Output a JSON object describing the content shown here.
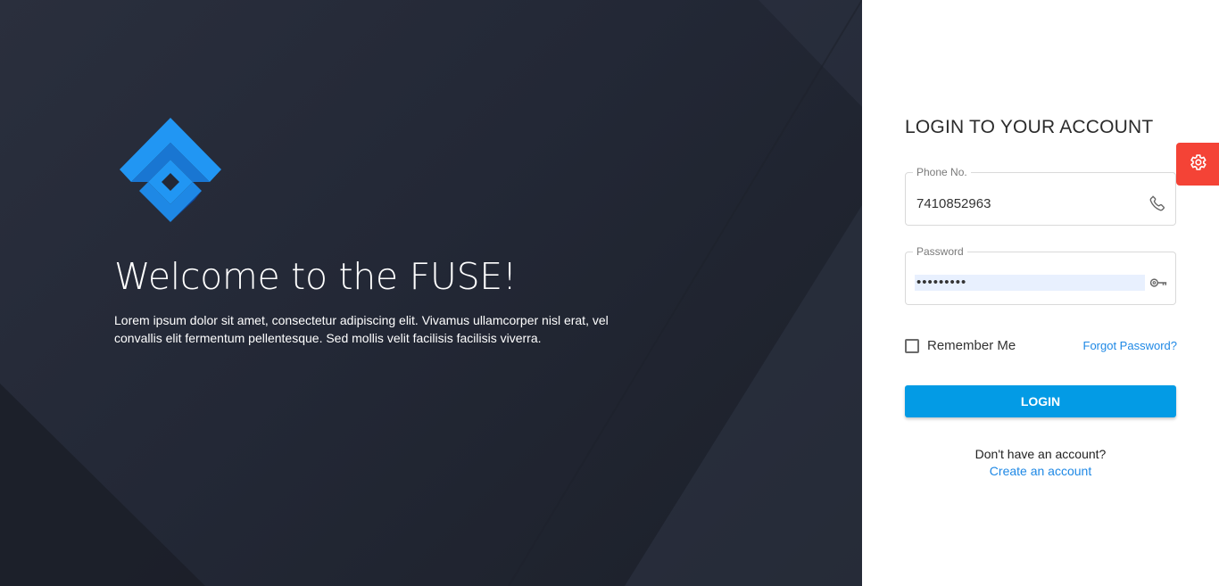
{
  "intro": {
    "title": "Welcome to the FUSE!",
    "description": "Lorem ipsum dolor sit amet, consectetur adipiscing elit. Vivamus ullamcorper nisl erat, vel convallis elit fermentum pellentesque. Sed mollis velit facilisis facilisis viverra.",
    "background_color": "#232836",
    "logo_icon": "fuse-logo-icon",
    "logo_colors": [
      "#2196f3",
      "#1976d2",
      "#0d47a1"
    ]
  },
  "login": {
    "heading": "LOGIN TO YOUR ACCOUNT",
    "phone": {
      "label": "Phone No.",
      "value": "7410852963",
      "icon": "phone-icon"
    },
    "password": {
      "label": "Password",
      "value": "•••••••••",
      "icon": "key-icon"
    },
    "remember_label": "Remember Me",
    "remember_checked": false,
    "forgot_label": "Forgot Password?",
    "submit_label": "LOGIN",
    "signup_prompt": "Don't have an account?",
    "signup_link": "Create an account",
    "accent_color": "#039be5",
    "link_color": "#1e88e5"
  },
  "settings": {
    "icon": "gear-icon",
    "color": "#f44336"
  }
}
